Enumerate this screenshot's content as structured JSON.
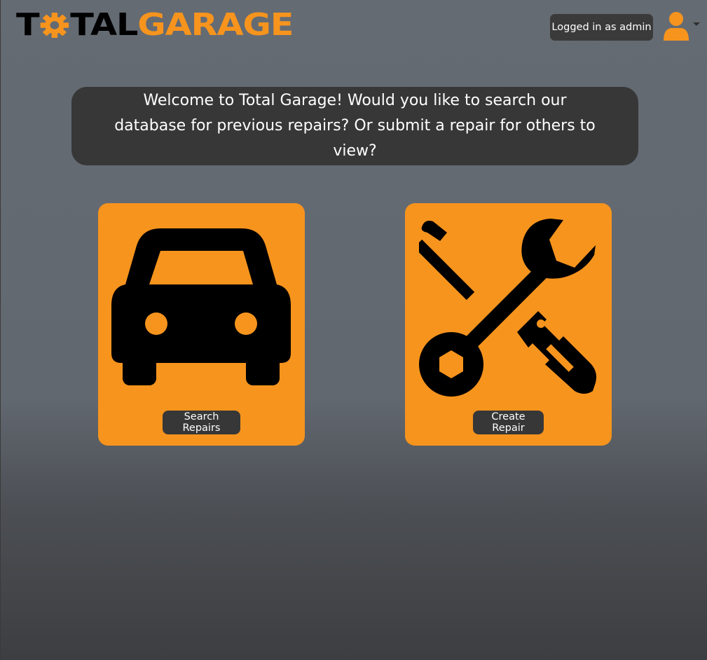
{
  "brand": {
    "part1": "T",
    "part2": "TAL",
    "part3": "GARAGE",
    "icon": "gear-icon"
  },
  "header": {
    "user_label": "Logged in as admin",
    "user_icon": "user-icon"
  },
  "welcome": {
    "text": "Welcome to Total Garage! Would you like to search our database for previous repairs? Or submit a repair for others to view?"
  },
  "cards": [
    {
      "icon": "car-icon",
      "button_label": "Search Repairs"
    },
    {
      "icon": "tools-icon",
      "button_label": "Create Repair"
    }
  ],
  "colors": {
    "accent": "#f7941d",
    "panel": "#373737",
    "background": "#646a72"
  }
}
